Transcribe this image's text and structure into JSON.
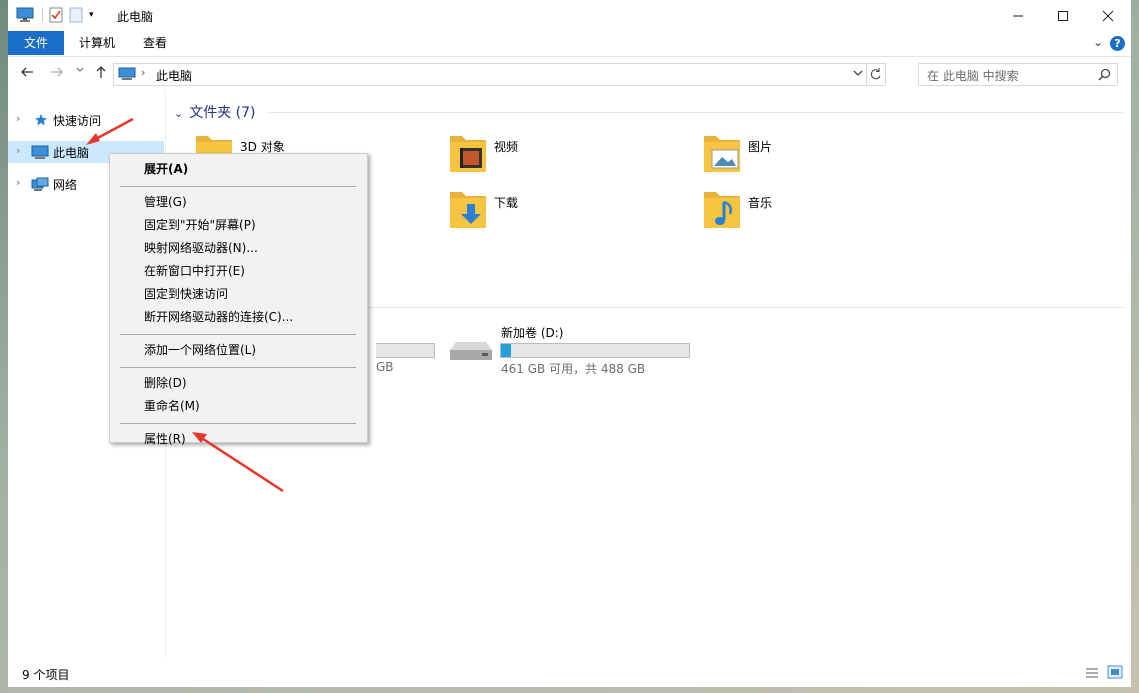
{
  "window": {
    "title": "此电脑",
    "controls": [
      "minimize",
      "maximize",
      "close"
    ]
  },
  "ribbon": {
    "tabs": [
      "文件",
      "计算机",
      "查看"
    ],
    "help_label": "?"
  },
  "address": {
    "path": "此电脑",
    "search_placeholder": "在 此电脑 中搜索"
  },
  "nav": {
    "items": [
      {
        "label": "快速访问",
        "icon": "star-icon"
      },
      {
        "label": "此电脑",
        "icon": "computer-icon",
        "selected": true
      },
      {
        "label": "网络",
        "icon": "network-icon"
      }
    ]
  },
  "content": {
    "folders_header": "文件夹 (7)",
    "folders": [
      {
        "label": "3D 对象",
        "icon": "folder-3d-icon"
      },
      {
        "label": "视频",
        "icon": "folder-video-icon"
      },
      {
        "label": "图片",
        "icon": "folder-pictures-icon"
      },
      {
        "label": "下载",
        "icon": "folder-downloads-icon"
      },
      {
        "label": "音乐",
        "icon": "folder-music-icon"
      }
    ],
    "drive_partial_text": "GB",
    "drive": {
      "label": "新加卷 (D:)",
      "info": "461 GB 可用，共 488 GB",
      "used_fraction": 0.055
    }
  },
  "status": {
    "item_count": "9 个项目"
  },
  "context_menu": {
    "items": [
      {
        "label": "展开(A)",
        "bold": true
      },
      {
        "separator": true
      },
      {
        "label": "管理(G)"
      },
      {
        "label": "固定到\"开始\"屏幕(P)"
      },
      {
        "label": "映射网络驱动器(N)..."
      },
      {
        "label": "在新窗口中打开(E)"
      },
      {
        "label": "固定到快速访问"
      },
      {
        "label": "断开网络驱动器的连接(C)..."
      },
      {
        "separator": true
      },
      {
        "label": "添加一个网络位置(L)"
      },
      {
        "separator": true
      },
      {
        "label": "删除(D)"
      },
      {
        "label": "重命名(M)"
      },
      {
        "separator": true
      },
      {
        "label": "属性(R)"
      }
    ]
  },
  "colors": {
    "accent": "#1a6ec7",
    "selection": "#cce8ff",
    "folder": "#f5c542",
    "progress": "#26a0da",
    "annotation_arrow": "#e8352a"
  }
}
